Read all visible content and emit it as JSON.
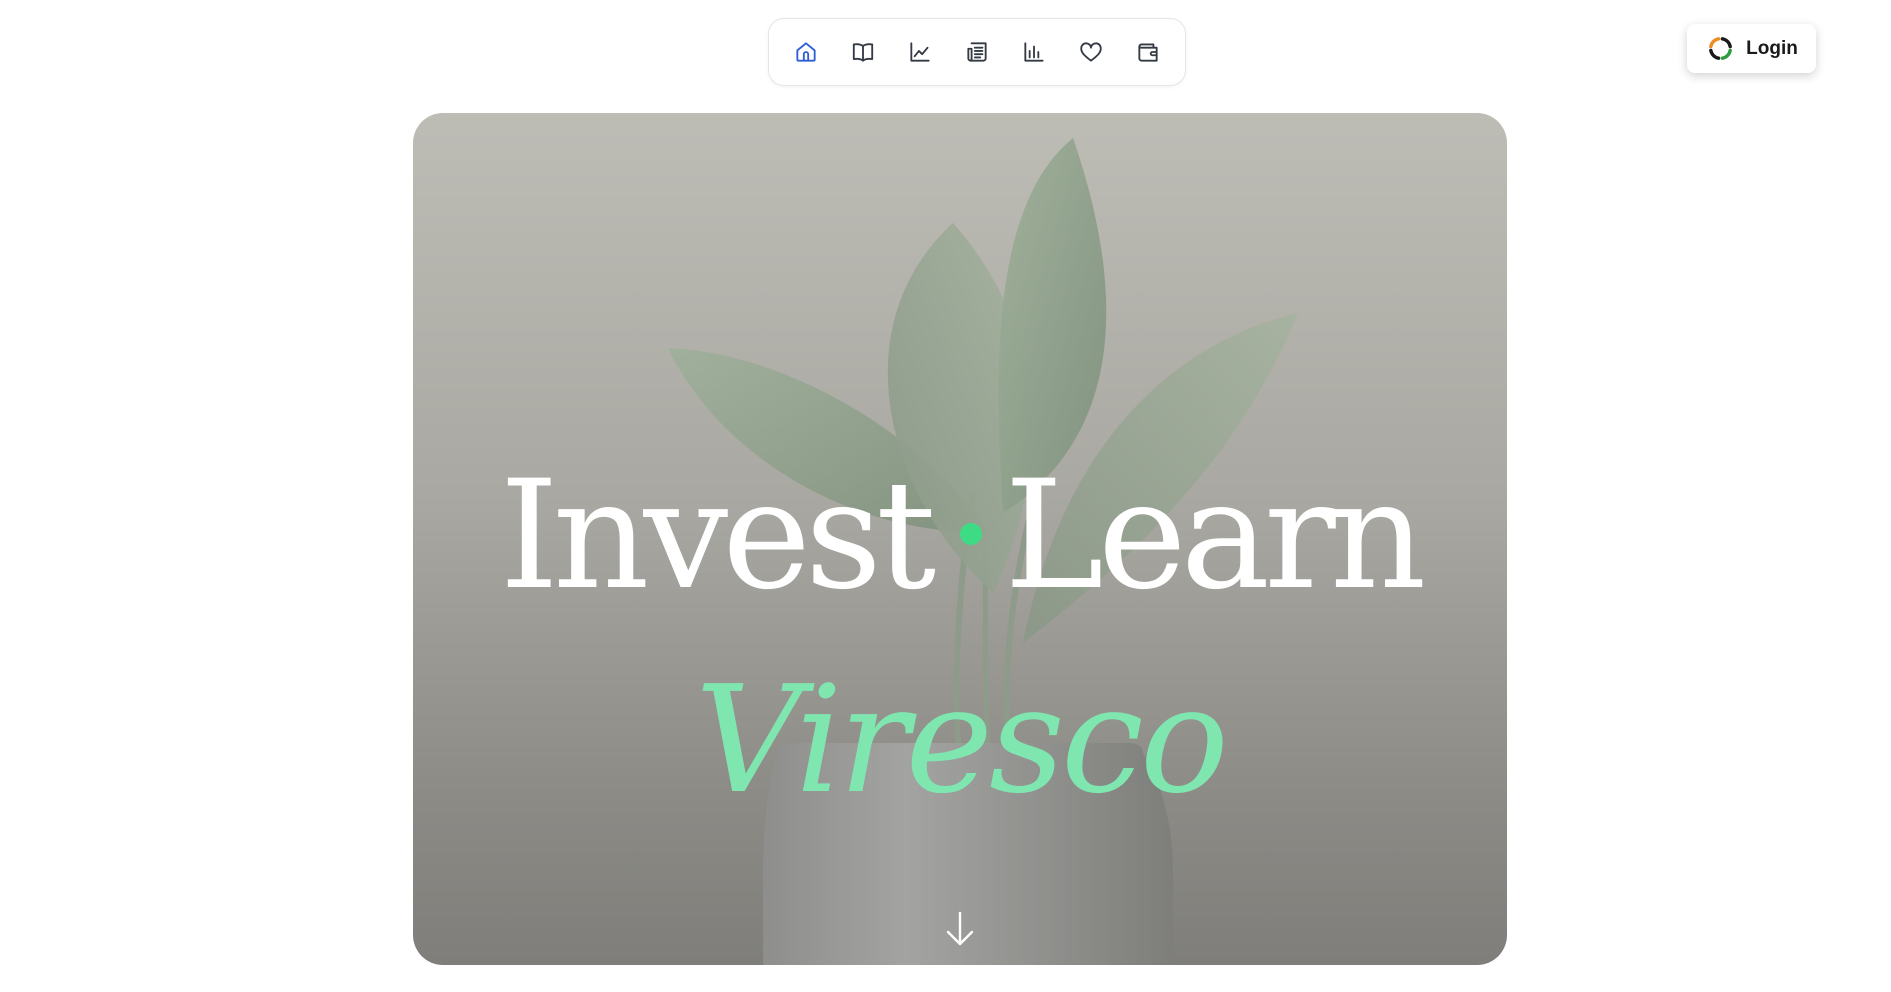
{
  "nav": {
    "items": [
      {
        "icon": "home-icon",
        "active": true
      },
      {
        "icon": "book-icon",
        "active": false
      },
      {
        "icon": "line-chart-icon",
        "active": false
      },
      {
        "icon": "newspaper-icon",
        "active": false
      },
      {
        "icon": "bar-chart-icon",
        "active": false
      },
      {
        "icon": "heart-icon",
        "active": false
      },
      {
        "icon": "wallet-icon",
        "active": false
      }
    ],
    "active_color": "#2d5fd6",
    "icon_color": "#333a44"
  },
  "login": {
    "label": "Login",
    "icon": "brand-ring-icon",
    "icon_colors": [
      "#f08a24",
      "#2e9b3e",
      "#1a1a1a"
    ]
  },
  "hero": {
    "title_left": "Invest",
    "title_right": "Learn",
    "brand_name": "Viresco",
    "brand_color": "#7fe6b0",
    "dot_color": "#3ddc84",
    "background_image": "potted-plant-image",
    "scroll_icon": "arrow-down-icon"
  }
}
